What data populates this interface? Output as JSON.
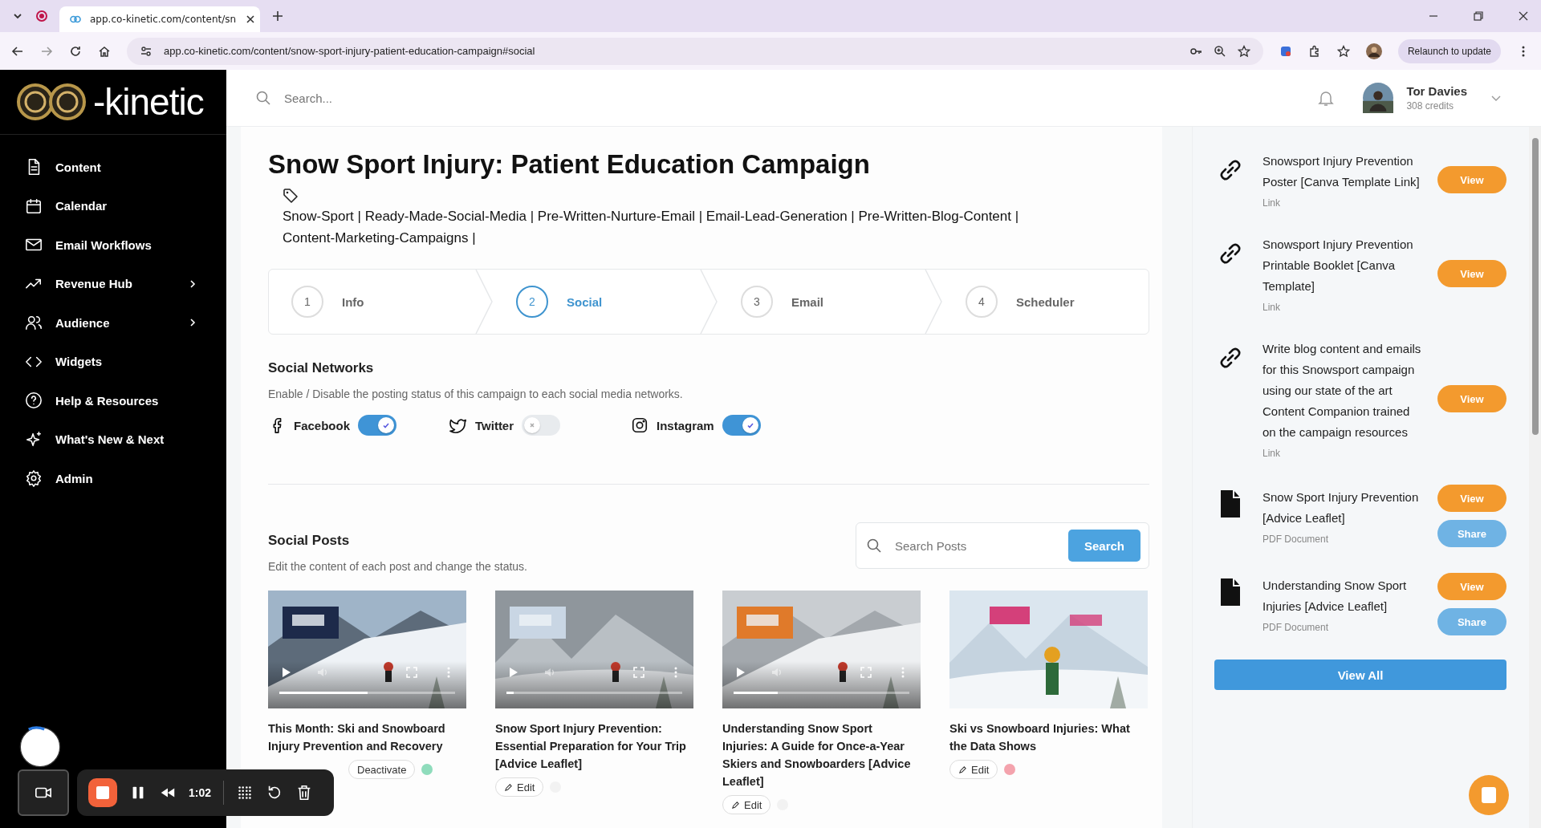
{
  "browser": {
    "tab_title": "app.co-kinetic.com/content/sn",
    "url": "app.co-kinetic.com/content/snow-sport-injury-patient-education-campaign#social",
    "relaunch": "Relaunch to update"
  },
  "logo": {
    "text": "-kinetic"
  },
  "sidebar": {
    "items": [
      {
        "label": "Content",
        "kind": "document",
        "has_submenu": false
      },
      {
        "label": "Calendar",
        "kind": "calendar",
        "has_submenu": false
      },
      {
        "label": "Email Workflows",
        "kind": "mail",
        "has_submenu": false
      },
      {
        "label": "Revenue Hub",
        "kind": "trend",
        "has_submenu": true
      },
      {
        "label": "Audience",
        "kind": "users",
        "has_submenu": true
      },
      {
        "label": "Widgets",
        "kind": "code",
        "has_submenu": false
      },
      {
        "label": "Help & Resources",
        "kind": "help",
        "has_submenu": false
      },
      {
        "label": "What's New & Next",
        "kind": "sparkle",
        "has_submenu": false
      },
      {
        "label": "Admin",
        "kind": "gear",
        "has_submenu": false
      }
    ]
  },
  "header": {
    "search_placeholder": "Search...",
    "user": {
      "name": "Tor Davies",
      "credits": "308 credits"
    }
  },
  "campaign": {
    "title": "Snow Sport Injury: Patient Education Campaign",
    "tags": "Snow-Sport | Ready-Made-Social-Media | Pre-Written-Nurture-Email | Email-Lead-Generation | Pre-Written-Blog-Content | Content-Marketing-Campaigns |",
    "steps": [
      {
        "number": "1",
        "label": "Info",
        "selected": false
      },
      {
        "number": "2",
        "label": "Social",
        "selected": true
      },
      {
        "number": "3",
        "label": "Email",
        "selected": false
      },
      {
        "number": "4",
        "label": "Scheduler",
        "selected": false
      }
    ],
    "social_networks": {
      "heading": "Social Networks",
      "description": "Enable / Disable the posting status of this campaign to each social media networks.",
      "networks": [
        {
          "name": "Facebook",
          "kind": "facebook",
          "on": true
        },
        {
          "name": "Twitter",
          "kind": "twitter",
          "on": false
        },
        {
          "name": "Instagram",
          "kind": "instagram",
          "on": true
        }
      ]
    },
    "social_posts": {
      "heading": "Social Posts",
      "description": "Edit the content of each post and change the status.",
      "search": {
        "placeholder": "Search Posts",
        "button": "Search"
      },
      "posts": [
        {
          "title": "This Month: Ski and Snowboard Injury Prevention and Recovery",
          "kind": "video",
          "level": 0.5,
          "actions": [
            {
              "label": "Deactivate",
              "kind": "deactivate"
            }
          ],
          "color": "#8fdcbc"
        },
        {
          "title": "Snow Sport Injury Prevention: Essential Preparation for Your Trip [Advice Leaflet]",
          "kind": "video",
          "level": 0.04,
          "actions": [
            {
              "label": "Edit",
              "kind": "edit"
            }
          ],
          "color": "#f2f2f2"
        },
        {
          "title": "Understanding Snow Sport Injuries: A Guide for Once-a-Year Skiers and Snowboarders [Advice Leaflet]",
          "kind": "video",
          "level": 0.25,
          "actions": [
            {
              "label": "Edit",
              "kind": "edit"
            }
          ],
          "color": "#f2f2f2"
        },
        {
          "title": "Ski vs Snowboard Injuries: What the Data Shows",
          "actions": [
            {
              "label": "Edit",
              "kind": "edit"
            }
          ],
          "color": "#f4a3ad"
        }
      ]
    }
  },
  "resources": {
    "items": [
      {
        "title": "Snowsport Injury Prevention Poster [Canva Template Link]",
        "type": "Link",
        "kind": "link",
        "buttons": [
          {
            "label": "View",
            "kind": "view"
          }
        ]
      },
      {
        "title": "Snowsport Injury Prevention Printable Booklet [Canva Template]",
        "type": "Link",
        "kind": "link",
        "buttons": [
          {
            "label": "View",
            "kind": "view"
          }
        ]
      },
      {
        "title": "Write blog content and emails for this Snowsport campaign using our state of the art Content Companion trained on the campaign resources",
        "type": "Link",
        "kind": "link",
        "buttons": [
          {
            "label": "View",
            "kind": "view"
          }
        ]
      },
      {
        "title": "Snow Sport Injury Prevention [Advice Leaflet]",
        "type": "PDF Document",
        "kind": "pdf",
        "buttons": [
          {
            "label": "View",
            "kind": "view"
          },
          {
            "label": "Share",
            "kind": "share"
          }
        ]
      },
      {
        "title": "Understanding Snow Sport Injuries [Advice Leaflet]",
        "type": "PDF Document",
        "kind": "pdf",
        "buttons": [
          {
            "label": "View",
            "kind": "view"
          },
          {
            "label": "Share",
            "kind": "share"
          }
        ]
      }
    ],
    "view_all": "View All"
  },
  "recorder": {
    "time": "1:02"
  }
}
